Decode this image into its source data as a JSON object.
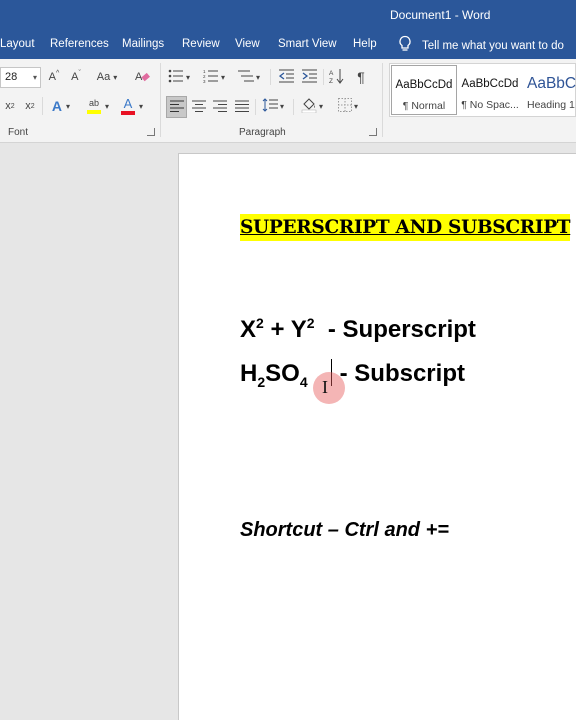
{
  "window": {
    "title": "Document1  -  Word"
  },
  "tabs": [
    {
      "label": "Layout"
    },
    {
      "label": "References"
    },
    {
      "label": "Mailings"
    },
    {
      "label": "Review"
    },
    {
      "label": "View"
    },
    {
      "label": "Smart View"
    },
    {
      "label": "Help"
    }
  ],
  "tell_me": {
    "placeholder": "Tell me what you want to do"
  },
  "ribbon": {
    "font": {
      "size_value": "28",
      "grow_label": "A",
      "shrink_label": "A",
      "change_case_label": "Aa",
      "subscript_label": "x",
      "subscript_mark": "2",
      "superscript_label": "x",
      "superscript_mark": "2",
      "text_effects_label": "A",
      "highlight_label": "ab",
      "font_color_label": "A",
      "group_label": "Font",
      "font_color_hex": "#e81123",
      "highlight_hex": "#ffff00"
    },
    "paragraph": {
      "group_label": "Paragraph",
      "show_marks_label": "¶"
    },
    "styles": [
      {
        "sample": "AaBbCcDd",
        "name": "¶ Normal",
        "selected": true
      },
      {
        "sample": "AaBbCcDd",
        "name": "¶ No Spac...",
        "selected": false
      },
      {
        "sample": "AaBbC",
        "name": "Heading 1",
        "selected": false
      }
    ]
  },
  "document": {
    "heading": "SUPERSCRIPT AND SUBSCRIPT",
    "line1": {
      "x": "X",
      "x_sup": "2",
      "plus": " + ",
      "y": "Y",
      "y_sup": "2",
      "label": "  - Superscript"
    },
    "line2": {
      "h": "H",
      "h_sub": "2",
      "so": "SO",
      "so_sub": "4",
      "label": "- Subscript"
    },
    "shortcut": "Shortcut – Ctrl and +="
  },
  "colors": {
    "brand": "#2b579a",
    "highlight": "#ffff00"
  }
}
